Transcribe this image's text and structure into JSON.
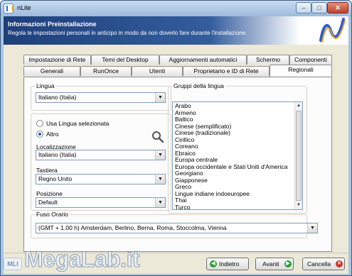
{
  "window": {
    "title": "nLite"
  },
  "header": {
    "title": "Informazioni Preinstallazione",
    "subtitle": "Regola le impostazioni personali in anticipo in modo da non doverlo fare durante l'installazione."
  },
  "tabs_row1": [
    "Impostazione di Rete",
    "Temi del Desktop",
    "Aggiornamenti automatici",
    "Schermo",
    "Componenti"
  ],
  "tabs_row2": [
    "Generali",
    "RunOnce",
    "Utenti",
    "Proprietario e ID di Rete",
    "Regionali"
  ],
  "active_tab": "Regionali",
  "lingua": {
    "label": "Lingua",
    "value": "Italiano (Italia)"
  },
  "options": {
    "radio_usa": "Usa Lingua selezionata",
    "radio_altro": "Altro",
    "selected": "Altro",
    "localizzazione": {
      "label": "Localizzazione",
      "value": "Italiano (Italia)"
    },
    "tastiera": {
      "label": "Tastiera",
      "value": "Regno Unito"
    },
    "posizione": {
      "label": "Posizione",
      "value": "Default"
    }
  },
  "gruppi": {
    "label": "Gruppi della lingua",
    "items": [
      "Arabo",
      "Armeno",
      "Baltico",
      "Cinese (semplificato)",
      "Cinese (tradizionale)",
      "Cirillico",
      "Coreano",
      "Ebraico",
      "Europa centrale",
      "Europa occidentale e Stati Uniti d'America",
      "Georgiano",
      "Giapponese",
      "Greco",
      "Lingue indiane indoeuropee",
      "Thai",
      "Turco"
    ]
  },
  "fuso": {
    "label": "Fuso Orario",
    "value": "(GMT + 1.00 h) Amsterdam, Berlino, Berna, Roma, Stoccolma, Vienna"
  },
  "buttons": {
    "back": "Indietro",
    "next": "Avanti",
    "cancel": "Cancella"
  },
  "watermark": {
    "text": "MegaLab.it",
    "badge": "MLI"
  },
  "colors": {
    "header_dark": "#1e3f7a",
    "accent_green": "#2e9d3a",
    "cancel_red": "#cc3322",
    "frame": "#aac4e0"
  },
  "icons": {
    "app": "nlite-app-icon",
    "search": "magnifier-icon",
    "logo": "nlite-logo"
  }
}
